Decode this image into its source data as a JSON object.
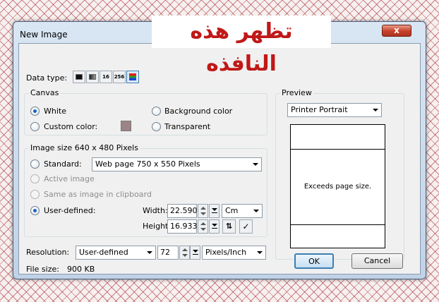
{
  "overlay": {
    "banner_text": "تظهر هذه النافذه"
  },
  "window": {
    "title": "New Image",
    "close_glyph": "x"
  },
  "data_type": {
    "label": "Data type:",
    "options": [
      "1-bit black and white",
      "8-bit grayscale",
      "16",
      "256",
      "24-bit color"
    ],
    "button_16": "16",
    "button_256": "256",
    "selected": "24-bit color"
  },
  "canvas": {
    "title": "Canvas",
    "white_label": "White",
    "background_color_label": "Background color",
    "custom_color_label": "Custom color:",
    "custom_color_swatch": "#9c8486",
    "transparent_label": "Transparent",
    "selected": "White"
  },
  "image_size": {
    "title": "Image size 640 x 480 Pixels",
    "standard_label": "Standard:",
    "standard_value": "Web page 750 x 550 Pixels",
    "active_image_label": "Active image",
    "clipboard_label": "Same as image in clipboard",
    "user_defined_label": "User-defined:",
    "width_label": "Width:",
    "width_value": "22.590",
    "height_label": "Height:",
    "height_value": "16.933",
    "unit_value": "Cm",
    "selected": "User-defined"
  },
  "resolution": {
    "label": "Resolution:",
    "preset_value": "User-defined",
    "value": "72",
    "unit_value": "Pixels/Inch"
  },
  "file_size": {
    "label": "File size:",
    "value": "900 KB"
  },
  "preview": {
    "title": "Preview",
    "paper_value": "Printer Portrait",
    "message": "Exceeds page size."
  },
  "buttons": {
    "ok": "OK",
    "cancel": "Cancel"
  },
  "colors": {
    "banner_text": "#c01818",
    "radio_dot": "#1b62c6",
    "ok_border": "#3c7fb1"
  }
}
